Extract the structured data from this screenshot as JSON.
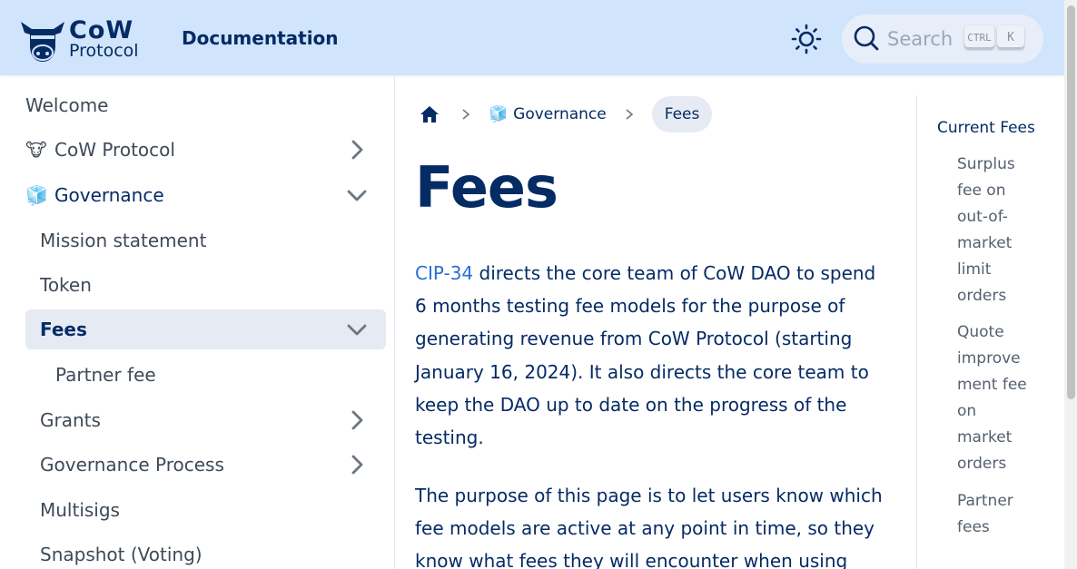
{
  "navbar": {
    "logo_line1": "CoW",
    "logo_line2": "Protocol",
    "title": "Documentation",
    "search_placeholder": "Search",
    "kbd_ctrl": "CTRL",
    "kbd_k": "K",
    "icons": {
      "logo": "cow-logo-icon",
      "theme": "sun-icon",
      "search": "search-icon"
    }
  },
  "sidebar": {
    "items": [
      {
        "label": "Welcome"
      },
      {
        "emoji": "🐮",
        "label": "CoW Protocol"
      },
      {
        "emoji": "🧊",
        "label": "Governance"
      },
      {
        "label": "Mission statement"
      },
      {
        "label": "Token"
      },
      {
        "label": "Fees"
      },
      {
        "label": "Partner fee"
      },
      {
        "label": "Grants"
      },
      {
        "label": "Governance Process"
      },
      {
        "label": "Multisigs"
      },
      {
        "label": "Snapshot (Voting)"
      }
    ]
  },
  "breadcrumb": {
    "home_icon": "home-icon",
    "section_emoji": "🧊",
    "section": "Governance",
    "current": "Fees"
  },
  "main": {
    "title": "Fees",
    "para1_link": "CIP-34",
    "para1_rest": " directs the core team of CoW DAO to spend 6 months testing fee models for the purpose of generating revenue from CoW Protocol (starting January 16, 2024). It also directs the core team to keep the DAO up to date on the progress of the testing.",
    "para2": "The purpose of this page is to let users know which fee models are active at any point in time, so they know what fees they will encounter when using"
  },
  "toc": {
    "top": "Current Fees",
    "items": [
      {
        "lines": [
          "Surplus",
          "fee on",
          "out-of-",
          "market",
          "limit",
          "orders"
        ]
      },
      {
        "lines": [
          "Quote",
          "improve",
          "ment fee",
          "on",
          "market",
          "orders"
        ]
      },
      {
        "lines": [
          "Partner",
          "fees"
        ]
      }
    ]
  },
  "colors": {
    "navbar_bg": "#d0e5fb",
    "primary": "#052b65",
    "link": "#2a6fd6",
    "active_bg": "#e6ebf3"
  }
}
